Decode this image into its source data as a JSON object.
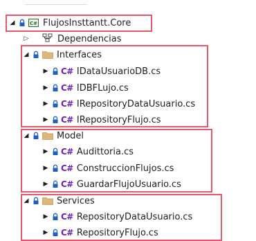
{
  "tree": {
    "project": {
      "label": "FlujosInsttantt.Core",
      "badge": "C#"
    },
    "dependencies": {
      "label": "Dependencias"
    },
    "folders": [
      {
        "label": "Interfaces",
        "files": [
          "IDataUsuarioDB.cs",
          "IDBFLujo.cs",
          "IRepositoryDataUsuario.cs",
          "IRepositoryFlujo.cs"
        ]
      },
      {
        "label": "Model",
        "files": [
          "Audittoria.cs",
          "ConstruccionFlujos.cs",
          "GuardarFlujoUsuario.cs"
        ]
      },
      {
        "label": "Services",
        "files": [
          "RepositoryDataUsuario.cs",
          "RepositoryFlujo.cs"
        ]
      }
    ],
    "file_badge": "C#",
    "icons": {
      "expanded": "triangle-down-icon",
      "collapsed": "triangle-right-icon",
      "lock": "padlock-icon",
      "folder": "folder-icon",
      "dependencies": "dependencies-icon"
    },
    "colors": {
      "highlight": "#e8566a",
      "folder": "#dcb67a",
      "csharp": "#6a1fb5",
      "lock": "#1f5fbf"
    }
  }
}
